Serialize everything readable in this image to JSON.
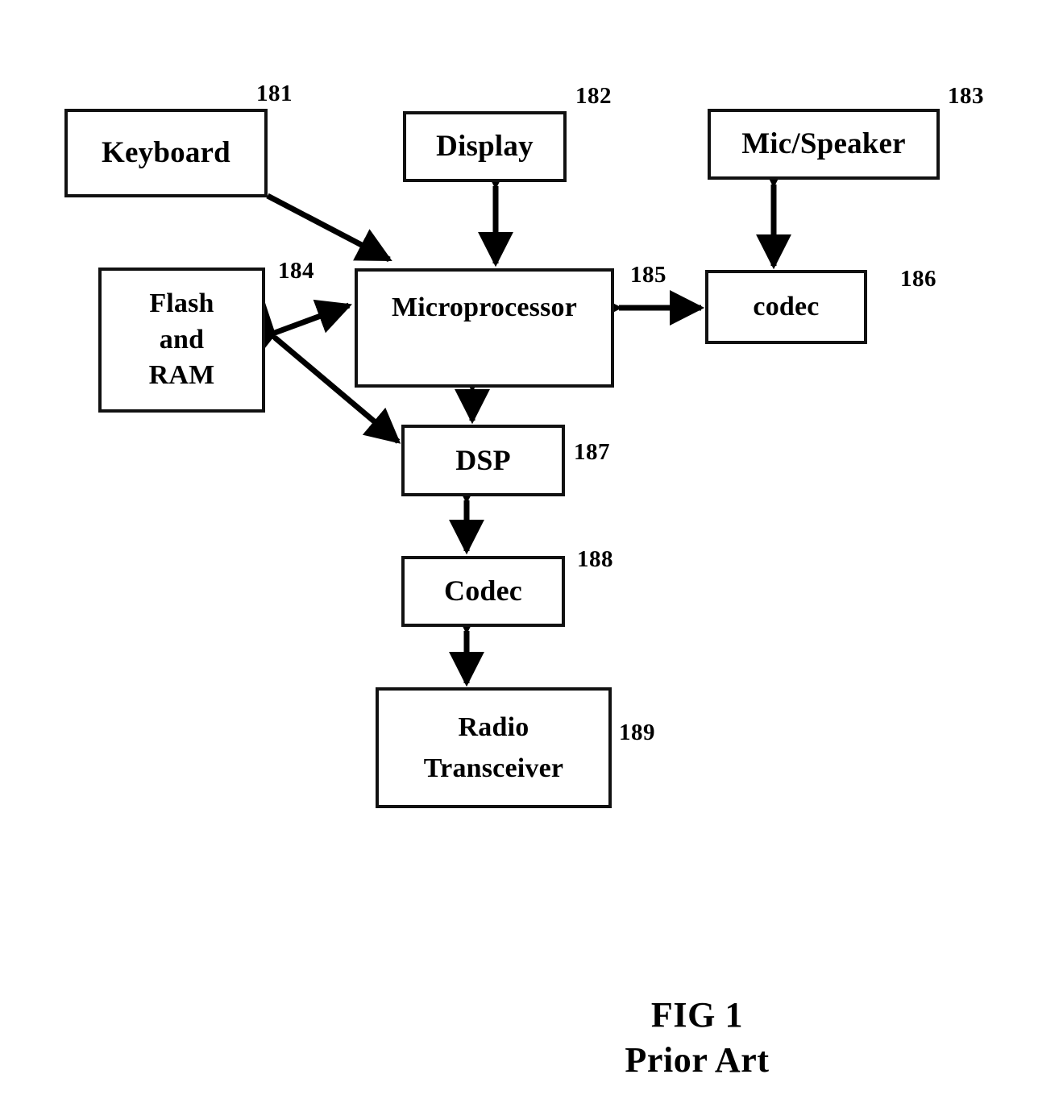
{
  "figure": {
    "caption_line1": "FIG 1",
    "caption_line2": "Prior Art"
  },
  "nodes": {
    "keyboard": {
      "label": "Keyboard",
      "ref": "181"
    },
    "display": {
      "label": "Display",
      "ref": "182"
    },
    "micspeaker": {
      "label": "Mic/Speaker",
      "ref": "183"
    },
    "flashram": {
      "label": "Flash\nand\nRAM",
      "ref": "184"
    },
    "micro": {
      "label": "Microprocessor",
      "ref": "185"
    },
    "codec_low": {
      "label": "codec",
      "ref": "186"
    },
    "dsp": {
      "label": "DSP",
      "ref": "187"
    },
    "codec_up": {
      "label": "Codec",
      "ref": "188"
    },
    "radio": {
      "label": "Radio\nTransceiver",
      "ref": "189"
    }
  },
  "connections": [
    {
      "name": "keyboard-to-microprocessor",
      "from": "keyboard",
      "to": "micro",
      "arrow": "single"
    },
    {
      "name": "display-microprocessor",
      "from": "display",
      "to": "micro",
      "arrow": "double"
    },
    {
      "name": "micspeaker-codec",
      "from": "micspeaker",
      "to": "codec_low",
      "arrow": "double"
    },
    {
      "name": "microprocessor-codec",
      "from": "micro",
      "to": "codec_low",
      "arrow": "double"
    },
    {
      "name": "flashram-microprocessor",
      "from": "flashram",
      "to": "micro",
      "arrow": "double"
    },
    {
      "name": "flashram-dsp",
      "from": "flashram",
      "to": "dsp",
      "arrow": "double"
    },
    {
      "name": "microprocessor-dsp",
      "from": "micro",
      "to": "dsp",
      "arrow": "double"
    },
    {
      "name": "dsp-codec",
      "from": "dsp",
      "to": "codec_up",
      "arrow": "double"
    },
    {
      "name": "codec-radio",
      "from": "codec_up",
      "to": "radio",
      "arrow": "double"
    }
  ],
  "style": {
    "ink": "#000000",
    "paper": "#ffffff"
  }
}
